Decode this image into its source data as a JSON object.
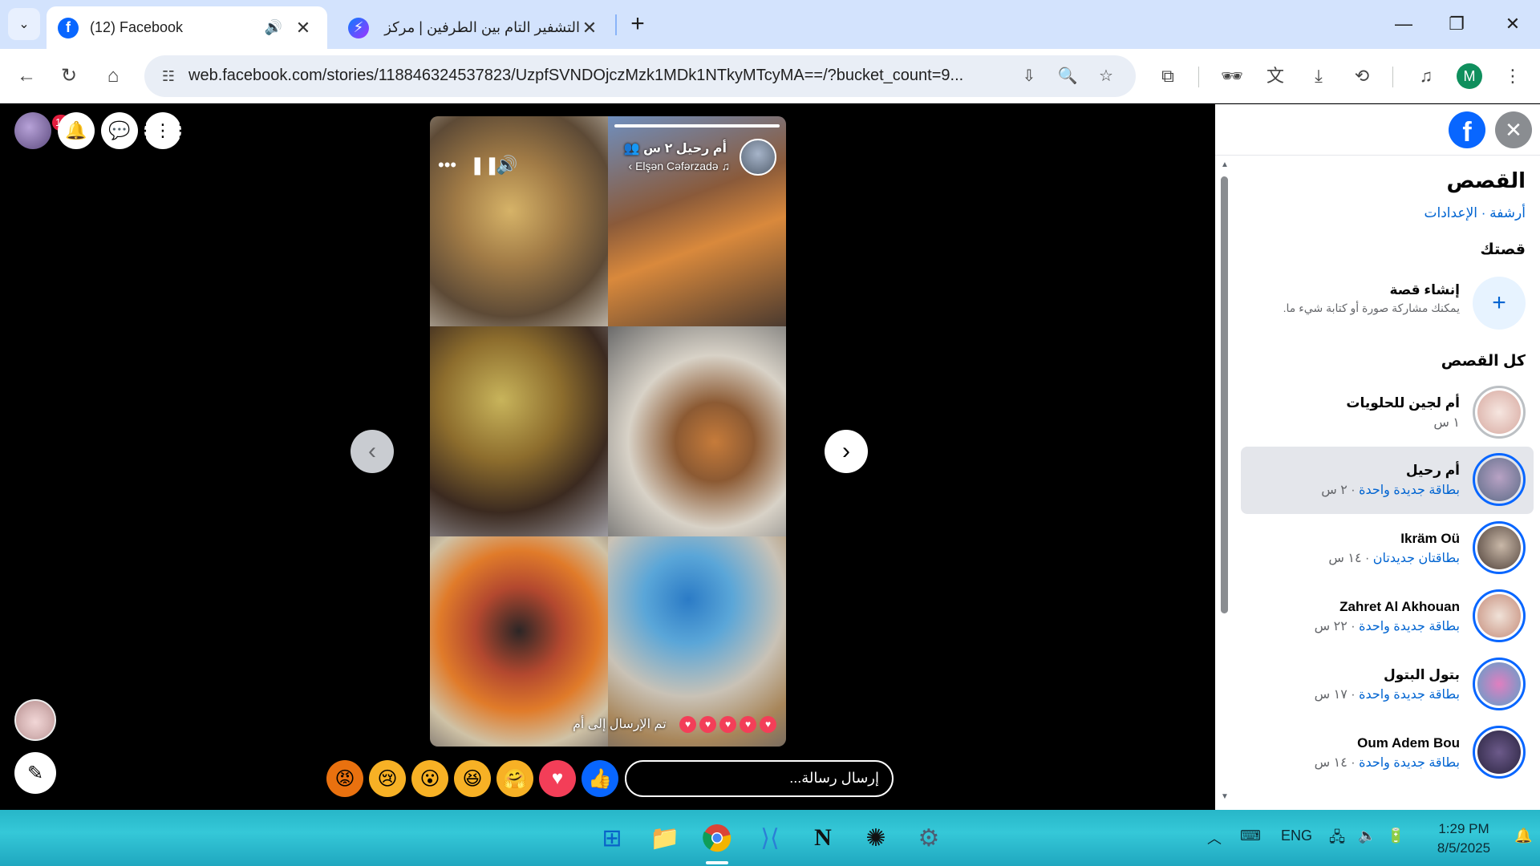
{
  "browser": {
    "tabs": [
      {
        "title": "(12) Facebook",
        "favicon": "facebook-icon",
        "active": true
      },
      {
        "title": "التشفير التام بين الطرفين | مركز ...",
        "favicon": "messenger-icon",
        "active": false
      }
    ],
    "url": "web.facebook.com/stories/118846324537823/UzpfSVNDOjczMzk1MDk1NTkyMTcyMA==/?bucket_count=9...",
    "profile_initial": "M"
  },
  "viewer": {
    "notifications_count": "12",
    "story": {
      "author": "أم رحيل",
      "time": "٢ س",
      "music": "Elşən Cəfərzadə",
      "sent_text": "تم الإرسال إلى أم"
    },
    "reply_placeholder": "إرسال رسالة...",
    "reactions": [
      "like",
      "love",
      "care",
      "haha",
      "wow",
      "sad",
      "angry"
    ]
  },
  "panel": {
    "title": "القصص",
    "links": "أرشفة · الإعدادات",
    "your_story_heading": "قصتك",
    "create_story_title": "إنشاء قصة",
    "create_story_sub": "يمكنك مشاركة صورة أو كتابة شيء ما.",
    "all_stories_heading": "كل القصص",
    "stories": [
      {
        "name": "أم لجين للحلويات",
        "new": "",
        "time": "١ س",
        "seen": true
      },
      {
        "name": "أم رحيل",
        "new": "بطاقة جديدة واحدة",
        "time": "٢ س",
        "seen": false,
        "selected": true
      },
      {
        "name": "Ikräm Oü",
        "new": "بطاقتان جديدتان",
        "time": "١٤ س",
        "seen": false
      },
      {
        "name": "Zahret Al Akhouan",
        "new": "بطاقة جديدة واحدة",
        "time": "٢٢ س",
        "seen": false
      },
      {
        "name": "بتول البتول",
        "new": "بطاقة جديدة واحدة",
        "time": "١٧ س",
        "seen": false
      },
      {
        "name": "Oum Adem Bou",
        "new": "بطاقة جديدة واحدة",
        "time": "١٤ س",
        "seen": false
      }
    ]
  },
  "taskbar": {
    "language": "ENG",
    "time": "1:29 PM",
    "date": "8/5/2025"
  }
}
